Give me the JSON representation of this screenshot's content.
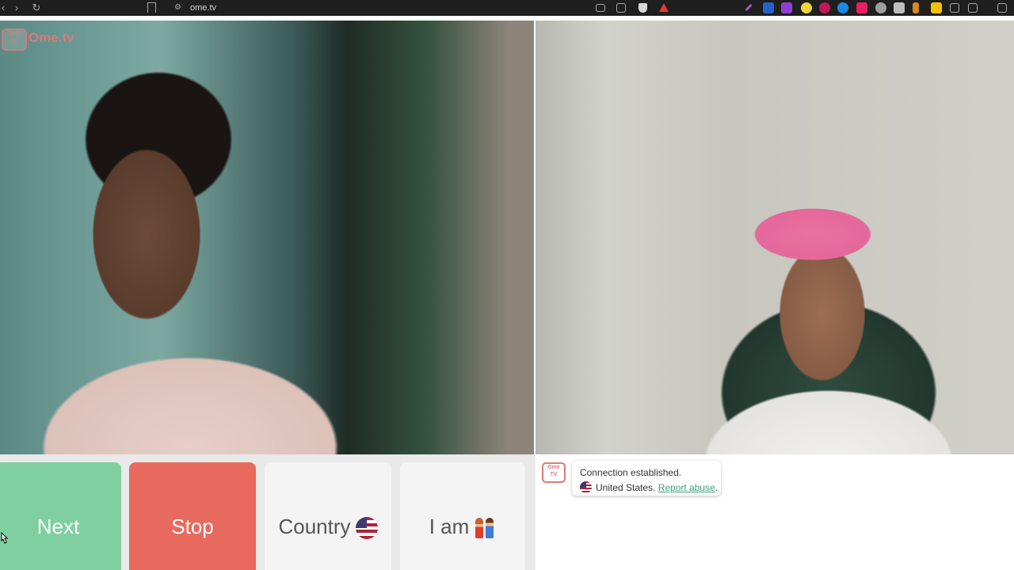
{
  "browser": {
    "url": "ome.tv",
    "nav": {
      "back": "‹",
      "forward": "›",
      "reload": "↻"
    }
  },
  "logo": {
    "badge": "Ome TV",
    "text": "Ome.tv"
  },
  "controls": {
    "next_label": "Next",
    "stop_label": "Stop",
    "country_label": "Country",
    "iam_label": "I am"
  },
  "chat": {
    "avatar": "Ome TV",
    "message_line1": "Connection established.",
    "message_country": "United States.",
    "report_link": "Report abuse",
    "report_suffix": "."
  },
  "colors": {
    "next": "#7fcfa0",
    "stop": "#e8695d",
    "brand": "#d97a7a",
    "link": "#3aa37a"
  }
}
